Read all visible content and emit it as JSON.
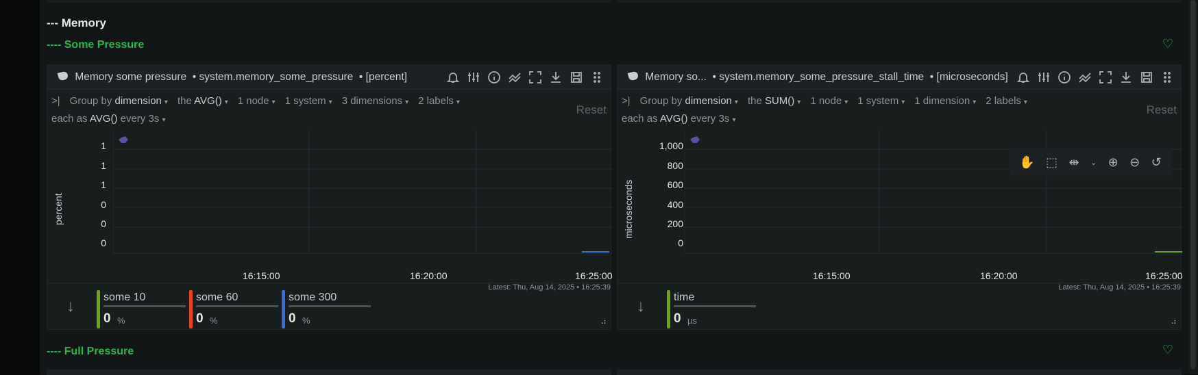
{
  "section": {
    "title": "--- Memory"
  },
  "some_pressure": {
    "title": "---- Some Pressure"
  },
  "full_pressure": {
    "title": "---- Full Pressure"
  },
  "colors": {
    "green": "#28b94a",
    "some10": "#6ca51c",
    "some60": "#e9431a",
    "some300": "#3a6fd9",
    "time": "#6ca51c"
  },
  "cards": [
    {
      "title": "Memory some pressure",
      "context": "• system.memory_some_pressure",
      "units": "• [percent]",
      "group": {
        "label": "Group by",
        "by": "dimension",
        "the": "the",
        "agg": "AVG()",
        "nodes": "1 node",
        "systems": "1 system",
        "dims": "3 dimensions",
        "labels": "2 labels"
      },
      "each": {
        "prefix": "each as",
        "agg": "AVG()",
        "every": "every 3s"
      },
      "reset": "Reset",
      "ylabel": "percent",
      "yticks": [
        "1",
        "1",
        "1",
        "0",
        "0",
        "0"
      ],
      "xticks": [
        "16:15:00",
        "16:20:00",
        "16:25:00"
      ],
      "latest": "Latest:  Thu, Aug 14, 2025 • 16:25:39",
      "dims": [
        {
          "name": "some 10",
          "value": "0",
          "unit": "%"
        },
        {
          "name": "some 60",
          "value": "0",
          "unit": "%"
        },
        {
          "name": "some 300",
          "value": "0",
          "unit": "%"
        }
      ]
    },
    {
      "title": "Memory so...",
      "context": "• system.memory_some_pressure_stall_time",
      "units": "• [microseconds]",
      "group": {
        "label": "Group by",
        "by": "dimension",
        "the": "the",
        "agg": "SUM()",
        "nodes": "1 node",
        "systems": "1 system",
        "dims": "1 dimension",
        "labels": "2 labels"
      },
      "each": {
        "prefix": "each as",
        "agg": "AVG()",
        "every": "every 3s"
      },
      "reset": "Reset",
      "ylabel": "microseconds",
      "yticks": [
        "1,000",
        "800",
        "600",
        "400",
        "200",
        "0"
      ],
      "xticks": [
        "16:15:00",
        "16:20:00",
        "16:25:00"
      ],
      "latest": "Latest:  Thu, Aug 14, 2025 • 16:25:39",
      "dims": [
        {
          "name": "time",
          "value": "0",
          "unit": "µs"
        }
      ]
    }
  ]
}
